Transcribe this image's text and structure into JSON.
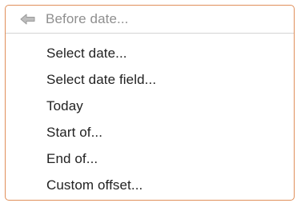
{
  "header": {
    "label": "Before date...",
    "icon": "arrow-left-icon"
  },
  "menu": {
    "items": [
      {
        "label": "Select date..."
      },
      {
        "label": "Select date field..."
      },
      {
        "label": "Today"
      },
      {
        "label": "Start of..."
      },
      {
        "label": "End of..."
      },
      {
        "label": "Custom offset..."
      }
    ]
  },
  "colors": {
    "border": "#e08f5a",
    "header_text": "#8f8f8f",
    "item_text": "#222222",
    "divider": "#d4d4d4"
  }
}
